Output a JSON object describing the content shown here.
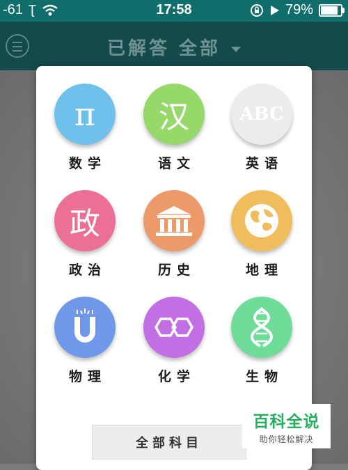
{
  "status_bar": {
    "signal": "-61",
    "time": "17:58",
    "battery_text": "79%",
    "battery_level": 0.79
  },
  "nav": {
    "title": "已解答 全部"
  },
  "subjects": [
    {
      "label": "数学",
      "glyph": "π",
      "color": "#6fc0ea",
      "icon": "pi-icon"
    },
    {
      "label": "语文",
      "glyph": "汉",
      "color": "#96d96a",
      "icon": "han-character-icon"
    },
    {
      "label": "英语",
      "glyph": "ABC",
      "color": "#ececec",
      "icon": "abc-icon"
    },
    {
      "label": "政治",
      "glyph": "政",
      "color": "#ec6f96",
      "icon": "zheng-character-icon"
    },
    {
      "label": "历史",
      "glyph": "",
      "color": "#ec9a6a",
      "icon": "temple-icon"
    },
    {
      "label": "地理",
      "glyph": "",
      "color": "#efbd5c",
      "icon": "globe-icon"
    },
    {
      "label": "物理",
      "glyph": "",
      "color": "#6f98ea",
      "icon": "magnet-icon"
    },
    {
      "label": "化学",
      "glyph": "",
      "color": "#c16fe3",
      "icon": "molecule-icon"
    },
    {
      "label": "生物",
      "glyph": "",
      "color": "#6fdd99",
      "icon": "dna-icon"
    }
  ],
  "all_subjects_button": "全部科目",
  "watermark": {
    "main": "百科全说",
    "sub": "助你轻松解决"
  }
}
